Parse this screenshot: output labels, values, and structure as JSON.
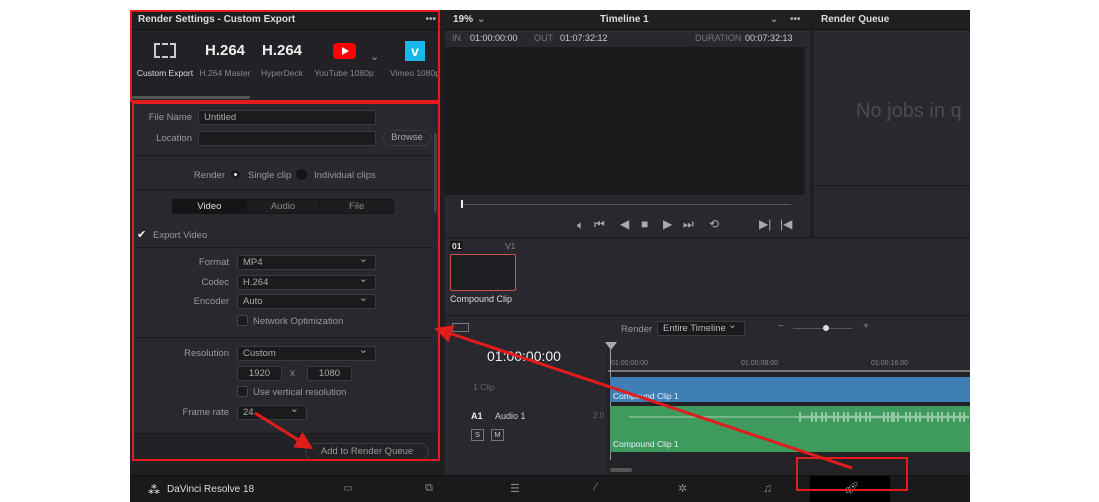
{
  "render_settings": {
    "title": "Render Settings - Custom Export",
    "menu_icon": "more-icon",
    "presets": [
      {
        "label": "Custom Export",
        "icon": "film-icon"
      },
      {
        "big": "H.264",
        "label": "H.264 Master"
      },
      {
        "big": "H.264",
        "label": "HyperDeck"
      },
      {
        "label": "YouTube 1080p",
        "icon": "youtube-icon",
        "color": "#ff0000"
      },
      {
        "label": "Vimeo 1080p",
        "icon": "vimeo-icon",
        "color": "#1ab7ea"
      }
    ],
    "file_name_label": "File Name",
    "file_name_value": "Untitled",
    "location_label": "Location",
    "location_value": "",
    "browse_label": "Browse",
    "render_label": "Render",
    "single_clip": "Single clip",
    "individual_clips": "Individual clips",
    "render_mode": "Single clip",
    "tabs": [
      "Video",
      "Audio",
      "File"
    ],
    "active_tab": "Video",
    "export_video": "Export Video",
    "export_video_checked": true,
    "format_label": "Format",
    "format": "MP4",
    "codec_label": "Codec",
    "codec": "H.264",
    "encoder_label": "Encoder",
    "encoder": "Auto",
    "network_opt": "Network Optimization",
    "network_opt_checked": false,
    "resolution_label": "Resolution",
    "resolution": "Custom",
    "width": "1920",
    "x": "x",
    "height": "1080",
    "vertical_res": "Use vertical resolution",
    "vertical_res_checked": false,
    "frame_rate_label": "Frame rate",
    "frame_rate": "24",
    "add_button": "Add to Render Queue"
  },
  "viewer": {
    "zoom": "19%",
    "timeline": "Timeline 1",
    "in_label": "IN",
    "in": "01:00:00:00",
    "out_label": "OUT",
    "out": "01:07:32:12",
    "duration_label": "DURATION",
    "duration": "00:07:32:13",
    "controls": [
      "volume-icon",
      "skip-to-start-icon",
      "step-back-icon",
      "stop-icon",
      "play-icon",
      "skip-to-end-icon",
      "loop-icon",
      "mark-in-icon",
      "mark-out-icon"
    ]
  },
  "render_queue": {
    "title": "Render Queue",
    "empty": "No jobs in q"
  },
  "clips": {
    "index": "01",
    "track": "V1",
    "clip_name": "Compound Clip"
  },
  "timeline": {
    "render_label": "Render",
    "render_range": "Entire Timeline",
    "zoom_minus": "−",
    "zoom_plus": "+",
    "timecode": "01:00:00:00",
    "ruler": [
      "01:00:00:00",
      "01:00:08:00",
      "01:00:16:00"
    ],
    "video_track_label": "1 Clip",
    "video_clip": "Compound Clip 1",
    "audio_track_id": "A1",
    "audio_track_name": "Audio 1",
    "audio_channels": "2.0",
    "solo": "S",
    "mute": "M",
    "audio_clip": "Compound Clip 1",
    "video_color": "#3f7fb4",
    "audio_color": "#3f9a5e"
  },
  "bottom_bar": {
    "app_name": "DaVinci Resolve 18",
    "pages": [
      "media-icon",
      "cut-icon",
      "edit-icon",
      "fusion-icon",
      "color-icon",
      "fairlight-icon",
      "deliver-icon"
    ],
    "active_page": "deliver-icon"
  },
  "annotation_color": "#e31b1b"
}
